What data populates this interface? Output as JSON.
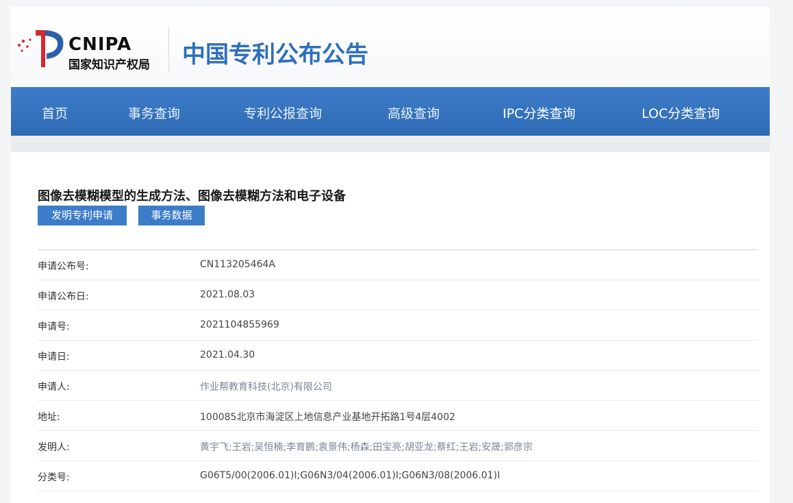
{
  "header": {
    "brand": "CNIPA",
    "brand_sub": "国家知识产权局",
    "site_title": "中国专利公布公告"
  },
  "nav": {
    "items": [
      {
        "label": "首页"
      },
      {
        "label": "事务查询"
      },
      {
        "label": "专利公报查询"
      },
      {
        "label": "高级查询"
      },
      {
        "label": "IPC分类查询"
      },
      {
        "label": "LOC分类查询"
      }
    ]
  },
  "document": {
    "title": "图像去模糊模型的生成方法、图像去模糊方法和电子设备",
    "buttons": {
      "patent_application": "发明专利申请",
      "transaction_data": "事务数据"
    },
    "fields": [
      {
        "label": "申请公布号:",
        "value": "CN113205464A"
      },
      {
        "label": "申请公布日:",
        "value": "2021.08.03"
      },
      {
        "label": "申请号:",
        "value": "2021104855969"
      },
      {
        "label": "申请日:",
        "value": "2021.04.30"
      },
      {
        "label": "申请人:",
        "value": "作业帮教育科技(北京)有限公司"
      },
      {
        "label": "地址:",
        "value": "100085北京市海淀区上地信息产业基地开拓路1号4层4002"
      },
      {
        "label": "发明人:",
        "value": "黄宇飞;王岩;吴恒楠;李育鹏;袁景伟;杨森;田宝亮;胡亚龙;蔡红;王岩;安晟;郭彦宗"
      },
      {
        "label": "分类号:",
        "value": "G06T5/00(2006.01)I;G06N3/04(2006.01)I;G06N3/08(2006.01)I"
      }
    ]
  },
  "colors": {
    "nav_bg": "#3672bf",
    "title_blue": "#2d6fbd",
    "button_bg": "#3d7cc8",
    "logo_red": "#d7282f"
  },
  "icons": {
    "logo": "cnipa-logo-icon"
  }
}
